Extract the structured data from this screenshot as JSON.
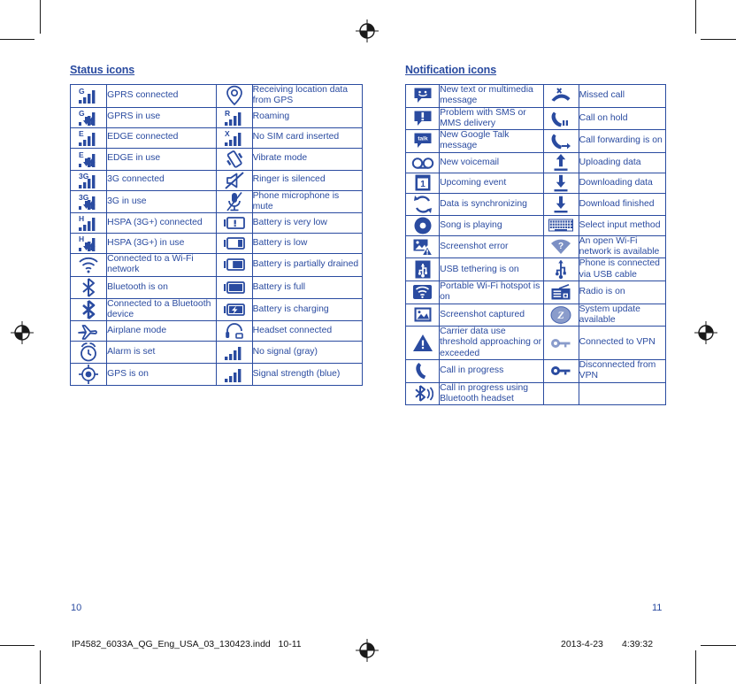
{
  "document": {
    "left_page_number": "10",
    "right_page_number": "11",
    "print_filename": "IP4582_6033A_QG_Eng_USA_03_130423.indd   10-11",
    "print_date": "2013-4-23",
    "print_time": "4:39:32",
    "accent_color": "#2a4ba0"
  },
  "status_section": {
    "title": "Status icons",
    "rows": [
      {
        "left_icon": "gprs-connected-icon",
        "left_label": "GPRS connected",
        "right_icon": "gps-location-pin-icon",
        "right_label": "Receiving location data from GPS"
      },
      {
        "left_icon": "gprs-in-use-icon",
        "left_label": "GPRS in use",
        "right_icon": "roaming-icon",
        "right_label": "Roaming"
      },
      {
        "left_icon": "edge-connected-icon",
        "left_label": "EDGE connected",
        "right_icon": "no-sim-card-icon",
        "right_label": "No SIM card inserted"
      },
      {
        "left_icon": "edge-in-use-icon",
        "left_label": "EDGE in use",
        "right_icon": "vibrate-mode-icon",
        "right_label": "Vibrate mode"
      },
      {
        "left_icon": "3g-connected-icon",
        "left_label": "3G connected",
        "right_icon": "ringer-silenced-icon",
        "right_label": "Ringer is silenced"
      },
      {
        "left_icon": "3g-in-use-icon",
        "left_label": "3G in use",
        "right_icon": "microphone-mute-icon",
        "right_label": "Phone microphone is mute"
      },
      {
        "left_icon": "hspa-connected-icon",
        "left_label": "HSPA (3G+) connected",
        "right_icon": "battery-very-low-icon",
        "right_label": "Battery is very low"
      },
      {
        "left_icon": "hspa-in-use-icon",
        "left_label": "HSPA (3G+) in use",
        "right_icon": "battery-low-icon",
        "right_label": "Battery is low"
      },
      {
        "left_icon": "wifi-connected-icon",
        "left_label": "Connected to a Wi-Fi network",
        "right_icon": "battery-partial-icon",
        "right_label": "Battery is partially drained"
      },
      {
        "left_icon": "bluetooth-on-icon",
        "left_label": "Bluetooth is on",
        "right_icon": "battery-full-icon",
        "right_label": "Battery is full"
      },
      {
        "left_icon": "bluetooth-connected-icon",
        "left_label": "Connected to a Bluetooth device",
        "right_icon": "battery-charging-icon",
        "right_label": "Battery is charging"
      },
      {
        "left_icon": "airplane-mode-icon",
        "left_label": "Airplane mode",
        "right_icon": "headset-connected-icon",
        "right_label": "Headset connected"
      },
      {
        "left_icon": "alarm-set-icon",
        "left_label": "Alarm is set",
        "right_icon": "no-signal-icon",
        "right_label": "No signal (gray)"
      },
      {
        "left_icon": "gps-on-icon",
        "left_label": "GPS is on",
        "right_icon": "signal-strength-icon",
        "right_label": "Signal strength (blue)"
      }
    ]
  },
  "notification_section": {
    "title": "Notification icons",
    "rows": [
      {
        "left_icon": "new-message-icon",
        "left_label": "New text or multimedia message",
        "right_icon": "missed-call-icon",
        "right_label": "Missed call"
      },
      {
        "left_icon": "message-problem-icon",
        "left_label": "Problem with SMS or MMS delivery",
        "right_icon": "call-on-hold-icon",
        "right_label": "Call on hold"
      },
      {
        "left_icon": "google-talk-icon",
        "left_label": "New Google Talk message",
        "right_icon": "call-forwarding-icon",
        "right_label": "Call forwarding is on"
      },
      {
        "left_icon": "voicemail-icon",
        "left_label": "New voicemail",
        "right_icon": "upload-icon",
        "right_label": "Uploading data"
      },
      {
        "left_icon": "calendar-event-icon",
        "left_label": "Upcoming event",
        "right_icon": "download-icon",
        "right_label": "Downloading data"
      },
      {
        "left_icon": "sync-icon",
        "left_label": "Data is synchronizing",
        "right_icon": "download-finished-icon",
        "right_label": "Download finished"
      },
      {
        "left_icon": "music-playing-icon",
        "left_label": "Song is playing",
        "right_icon": "keyboard-icon",
        "right_label": "Select input method"
      },
      {
        "left_icon": "screenshot-error-icon",
        "left_label": "Screenshot error",
        "right_icon": "open-wifi-icon",
        "right_label": "An open Wi-Fi network is available"
      },
      {
        "left_icon": "usb-tethering-icon",
        "left_label": "USB tethering is on",
        "right_icon": "usb-cable-icon",
        "right_label": "Phone is connected via USB cable"
      },
      {
        "left_icon": "wifi-hotspot-icon",
        "left_label": "Portable Wi-Fi hotspot is on",
        "right_icon": "radio-icon",
        "right_label": "Radio is on"
      },
      {
        "left_icon": "screenshot-captured-icon",
        "left_label": "Screenshot captured",
        "right_icon": "system-update-icon",
        "right_label": "System update available"
      },
      {
        "left_icon": "data-warning-icon",
        "left_label": "Carrier data use threshold approaching or exceeded",
        "right_icon": "vpn-connected-icon",
        "right_label": "Connected to VPN"
      },
      {
        "left_icon": "call-in-progress-icon",
        "left_label": "Call in progress",
        "right_icon": "vpn-disconnected-icon",
        "right_label": "Disconnected from VPN"
      },
      {
        "left_icon": "bluetooth-call-icon",
        "left_label": "Call in progress using Bluetooth headset",
        "right_icon": "",
        "right_label": ""
      }
    ]
  }
}
